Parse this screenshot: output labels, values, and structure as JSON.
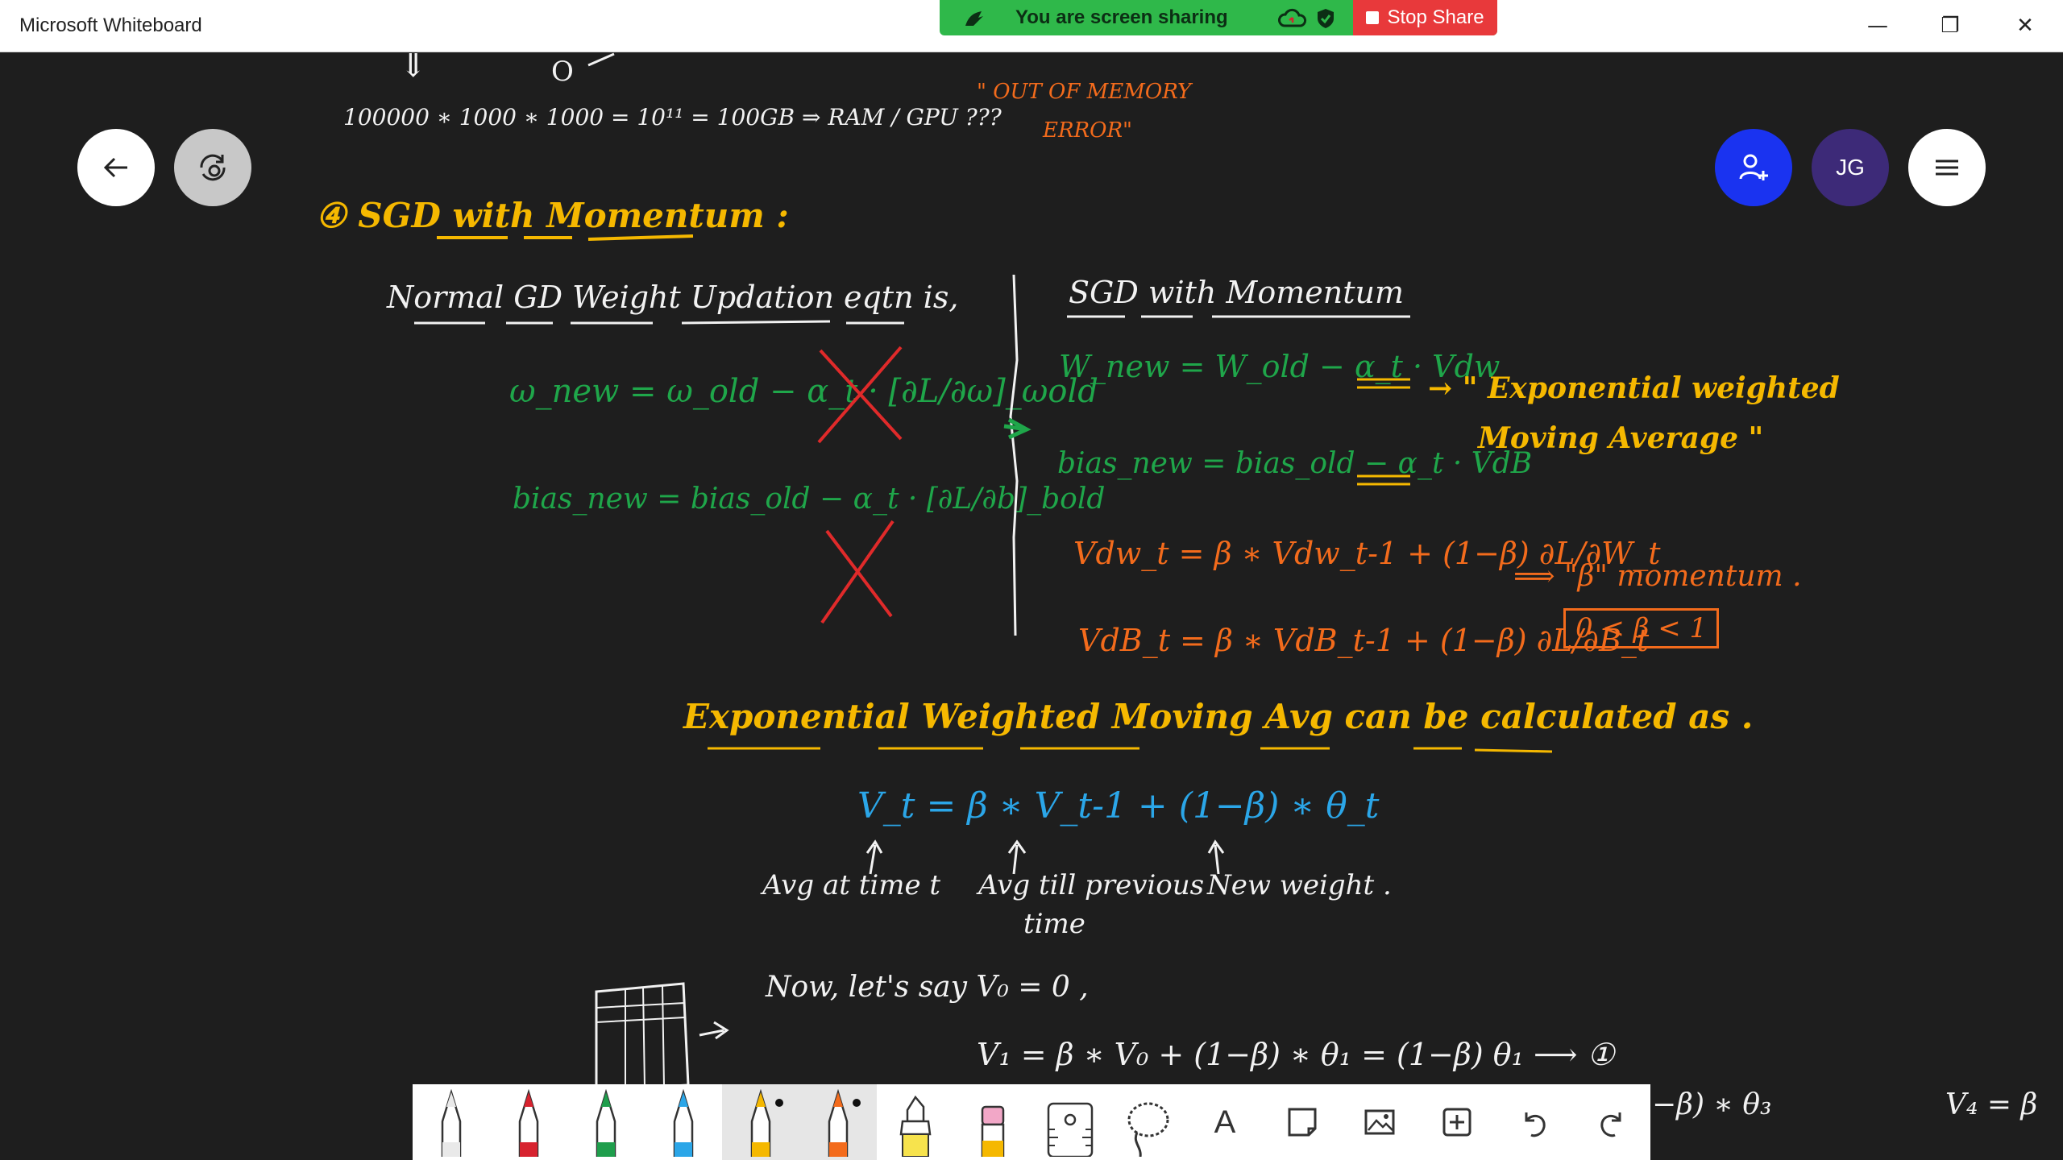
{
  "window": {
    "title": "Microsoft Whiteboard",
    "minimize": "—",
    "restore": "❐",
    "close": "✕"
  },
  "share_bar": {
    "status": "You are screen sharing",
    "stop_label": "Stop Share"
  },
  "nav": {
    "back_icon": "arrow-left-icon",
    "view_icon": "fit-view-icon"
  },
  "header_right": {
    "avatar_initials": "JG",
    "invite_icon": "add-person-icon",
    "menu_icon": "hamburger-menu-icon"
  },
  "colors": {
    "canvas": "#1e1e1e",
    "white_ink": "#f2f2f2",
    "green_ink": "#1fa64a",
    "orange_ink": "#f36b1c",
    "yellow_ink": "#f5b800",
    "blue_ink": "#2ba6e8",
    "invite_blue": "#1a33f0",
    "avatar_purple": "#3d2a78",
    "share_green": "#2fb84a",
    "stop_red": "#e8393b"
  },
  "notes": {
    "top_arrow": "⇓",
    "top_zero": "O",
    "memory_calc": "100000 ∗ 1000 ∗ 1000 = 10¹¹ = 100GB ⇒ RAM / GPU ???",
    "oom_line1": "\" OUT OF MEMORY",
    "oom_line2": "ERROR\"",
    "section_title": "④ SGD with Momentum :",
    "normal_gd_heading": "Normal GD Weight Updation eqtn is,",
    "w_new_eq": "ω_new = ω_old − α_t · [∂L/∂ω]_ωold",
    "bias_new_eq": "bias_new = bias_old − α_t · [∂L/∂b]_bold",
    "sgd_momentum_heading": "SGD with Momentum",
    "w_new_mom": "W_new = W_old − α_t · Vdw",
    "bias_new_mom": "bias_new = bias_old − α_t · VdB",
    "ewma_note_line1": "→ \" Exponential weighted",
    "ewma_note_line2": "Moving Average \"",
    "vdw_eq": "Vdw_t = β ∗ Vdw_t-1 + (1−β) ∂L/∂W_t",
    "momentum_note": "⟹ \"β\" momentum .",
    "beta_range": "0 < β < 1",
    "vdb_eq": "VdB_t = β ∗ VdB_t-1 + (1−β) ∂L/∂B_t",
    "ewma_title": "Exponential Weighted Moving Avg can be calculated as .",
    "vt_eq": "V_t = β ∗ V_t-1 + (1−β) ∗ θ_t",
    "label_avg_at_time": "Avg at time t",
    "label_avg_prev_1": "Avg till previous",
    "label_avg_prev_2": "time",
    "label_new_weight": "New weight .",
    "now_lets_say": "Now, let's say V₀ = 0 ,",
    "v1_eq": "V₁ = β ∗ V₀ + (1−β) ∗ θ₁ = (1−β) θ₁ ⟶ ①",
    "partial_right_1": "−β) ∗ θ₃",
    "partial_right_2": "V₄ = β"
  },
  "toolbar": {
    "tools": [
      {
        "name": "pen-white",
        "color": "#e9e9e9"
      },
      {
        "name": "pen-red",
        "color": "#d7232f"
      },
      {
        "name": "pen-green",
        "color": "#1f9e4c"
      },
      {
        "name": "pen-blue",
        "color": "#2ba6e8"
      },
      {
        "name": "pen-yellow",
        "color": "#f5b800",
        "selected": true
      },
      {
        "name": "pen-orange",
        "color": "#f36b1c",
        "selected": true
      },
      {
        "name": "highlighter",
        "color": "#f7e34d"
      },
      {
        "name": "eraser",
        "color": "#f2a7c7"
      },
      {
        "name": "ruler-icon"
      },
      {
        "name": "lasso-icon"
      },
      {
        "name": "text-icon",
        "label": "A"
      },
      {
        "name": "sticky-note-icon"
      },
      {
        "name": "image-icon"
      },
      {
        "name": "add-icon"
      },
      {
        "name": "undo-icon"
      },
      {
        "name": "redo-icon"
      }
    ]
  }
}
